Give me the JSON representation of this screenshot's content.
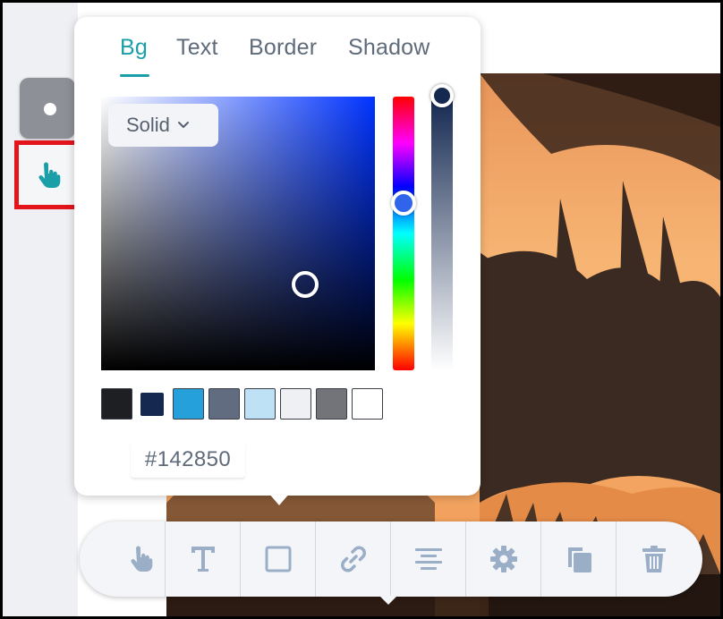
{
  "picker": {
    "tabs": [
      {
        "label": "Bg",
        "active": true
      },
      {
        "label": "Text",
        "active": false
      },
      {
        "label": "Border",
        "active": false
      },
      {
        "label": "Shadow",
        "active": false
      }
    ],
    "fill_type": "Solid",
    "hex": "#142850",
    "swatches": [
      "#1d1f23",
      "#142850",
      "#26a0da",
      "#616c80",
      "#bfe1f6",
      "#eef0f3",
      "#727479",
      "#ffffff"
    ]
  },
  "left_panel": {
    "color_button_icon": "circle-dot-icon",
    "interaction_button_icon": "hand-pointer-icon",
    "accent": "#1a9fa8",
    "highlight": "#e3141a"
  },
  "toolbar": {
    "icons": [
      "hand-pointer-icon",
      "text-icon",
      "square-icon",
      "link-icon",
      "align-center-icon",
      "gear-icon",
      "copy-icon",
      "trash-icon"
    ],
    "icon_color": "#9aaec8"
  }
}
